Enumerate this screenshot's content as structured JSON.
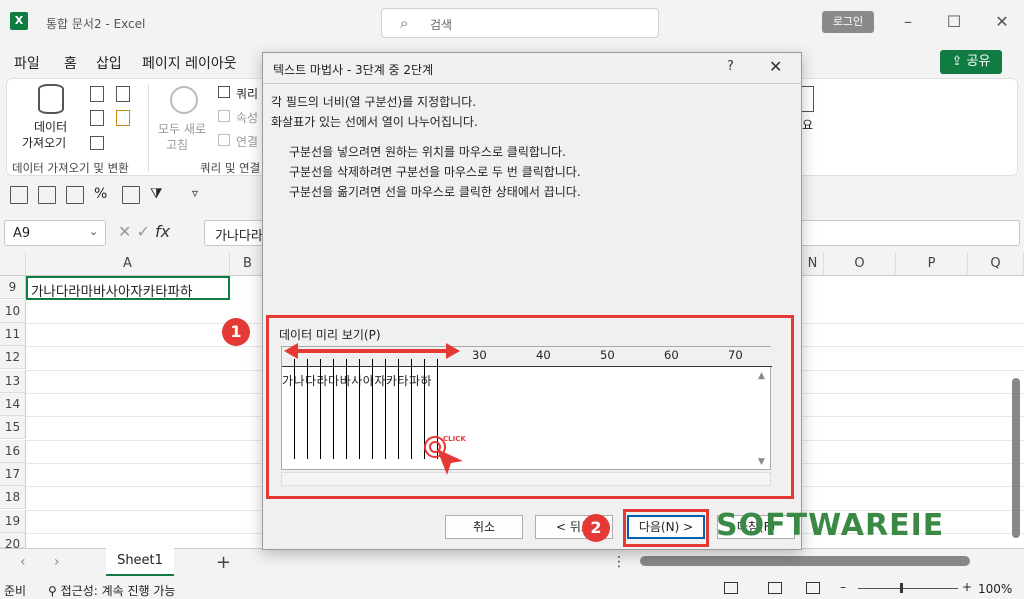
{
  "app": {
    "title": "통합 문서2 - Excel",
    "search_placeholder": "검색",
    "login_label": "로그인",
    "share_label": "공유",
    "accent_color": "#107c41"
  },
  "menu": [
    "파일",
    "홈",
    "삽입",
    "페이지 레이아웃"
  ],
  "ribbon": {
    "get_data_label_1": "데이터",
    "get_data_label_2": "가져오기",
    "group1_label": "데이터 가져오기 및 변환",
    "refresh_all_1": "모두 새로",
    "refresh_all_2": "고침",
    "queries": "쿼리",
    "properties": "속성",
    "links": "연결",
    "group2_label": "쿼리 및 연결",
    "cut_text": "요"
  },
  "formula": {
    "namebox": "A9",
    "fx": "fx",
    "value": "가나다라"
  },
  "grid": {
    "columns": [
      "A",
      "B",
      "N",
      "O",
      "P",
      "Q"
    ],
    "rows": [
      "9",
      "10",
      "11",
      "12",
      "13",
      "14",
      "15",
      "16",
      "17",
      "18",
      "19",
      "20"
    ],
    "cell_a9": "가나다라마바사아자카타파하"
  },
  "sheet": {
    "tab": "Sheet1",
    "add": "+"
  },
  "status": {
    "mode": "준비",
    "accessibility": "접근성: 계속 진행 가능",
    "zoom": "100%"
  },
  "dialog": {
    "title": "텍스트 마법사 - 3단계 중 2단계",
    "help": "?",
    "close": "✕",
    "line1": "각 필드의 너비(열 구분선)를 지정합니다.",
    "line2": "화살표가 있는 선에서 열이 나누어집니다.",
    "instr1": "구분선을 넣으려면 원하는 위치를 마우스로 클릭합니다.",
    "instr2": "구분선을 삭제하려면 구분선을 마우스로 두 번 클릭합니다.",
    "instr3": "구분선을 옮기려면 선을 마우스로 클릭한 상태에서 끕니다.",
    "preview_label": "데이터 미리 보기(P)",
    "ruler": [
      "30",
      "40",
      "50",
      "60",
      "70"
    ],
    "preview_text": "가나다라마바사아자카타파하",
    "click_text": "CLICK",
    "btn_cancel": "취소",
    "btn_back": "< 뒤로",
    "btn_next": "다음(N) >",
    "btn_finish": "마침(F)"
  },
  "annotations": {
    "badge1": "1",
    "badge2": "2",
    "highlight_color": "#e53935"
  },
  "watermark": "SOFTWAREIE"
}
